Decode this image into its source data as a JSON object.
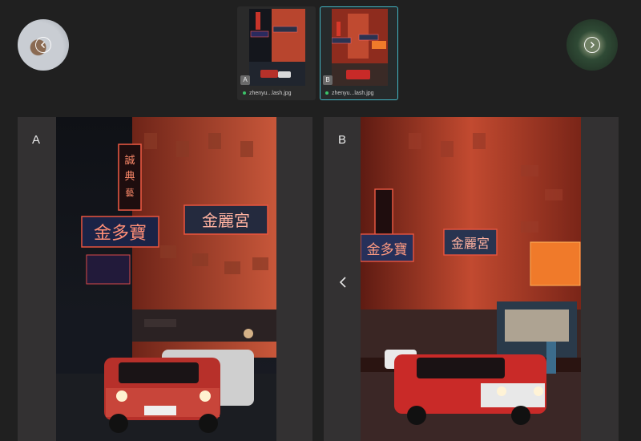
{
  "thumbnails": [
    {
      "badge": "A",
      "filename": "zhenyu...lash.jpg",
      "selected": false
    },
    {
      "badge": "B",
      "filename": "zhenyu...lash.jpg",
      "selected": true
    }
  ],
  "panels": [
    {
      "label": "A"
    },
    {
      "label": "B"
    }
  ],
  "colors": {
    "selection": "#43b6c4",
    "status_dot": "#3cc46a",
    "neon_red": "#e8402b"
  },
  "icons": {
    "prev": "chevron-left-icon",
    "next": "chevron-right-icon",
    "panel_nav": "chevron-left-icon"
  }
}
